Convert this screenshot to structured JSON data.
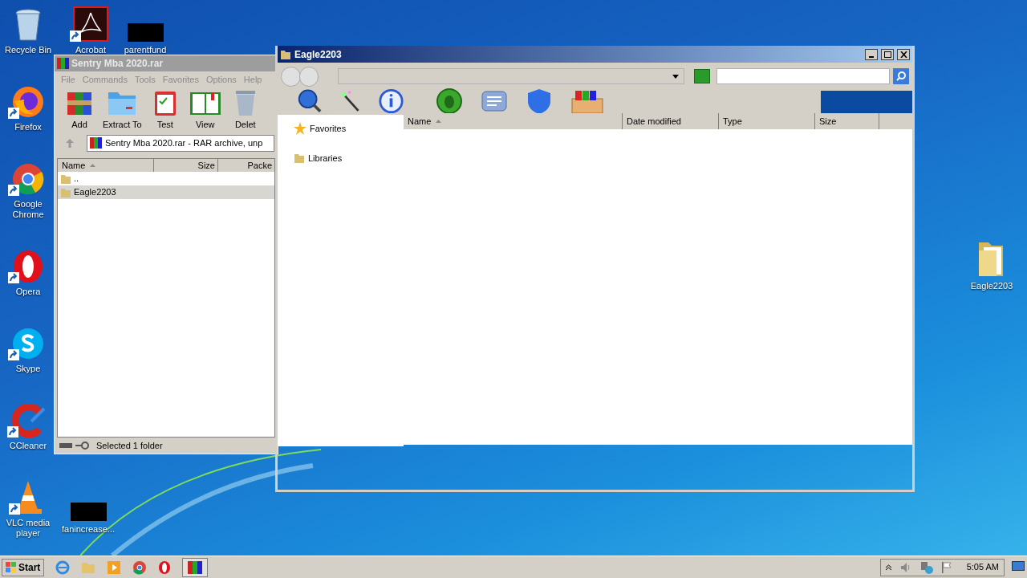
{
  "desktop_icons_left": [
    {
      "label": "Recycle Bin",
      "kind": "recycle",
      "shortcut": false
    },
    {
      "label": "Firefox",
      "kind": "firefox",
      "shortcut": true
    },
    {
      "label": "Google Chrome",
      "kind": "chrome",
      "shortcut": true
    },
    {
      "label": "Opera",
      "kind": "opera",
      "shortcut": true
    },
    {
      "label": "Skype",
      "kind": "skype",
      "shortcut": true
    },
    {
      "label": "CCleaner",
      "kind": "ccleaner",
      "shortcut": true
    },
    {
      "label": "VLC media player",
      "kind": "vlc",
      "shortcut": true
    }
  ],
  "desktop_icons_other": [
    {
      "label": "Acrobat",
      "kind": "acrobat",
      "shortcut": true
    },
    {
      "label": "parentfund",
      "kind": "redacted",
      "shortcut": false
    },
    {
      "label": "fanincrease...",
      "kind": "redacted",
      "shortcut": false
    },
    {
      "label": "Eagle2203",
      "kind": "folder",
      "shortcut": false
    }
  ],
  "winrar": {
    "title": "Sentry Mba 2020.rar",
    "menu": [
      "File",
      "Commands",
      "Tools",
      "Favorites",
      "Options",
      "Help"
    ],
    "toolbar": [
      "Add",
      "Extract To",
      "Test",
      "View",
      "Delet"
    ],
    "path": "Sentry Mba 2020.rar - RAR archive, unp",
    "columns": [
      "Name",
      "Size",
      "Packe"
    ],
    "rows": [
      {
        "name": "..",
        "selected": false
      },
      {
        "name": "Eagle2203",
        "selected": true
      }
    ],
    "status": "Selected 1 folder"
  },
  "explorer": {
    "title": "Eagle2203",
    "nav_pane": [
      "Favorites",
      "Libraries"
    ],
    "columns": [
      "Name",
      "Date modified",
      "Type",
      "Size"
    ]
  },
  "taskbar": {
    "start": "Start",
    "clock": "5:05 AM"
  }
}
